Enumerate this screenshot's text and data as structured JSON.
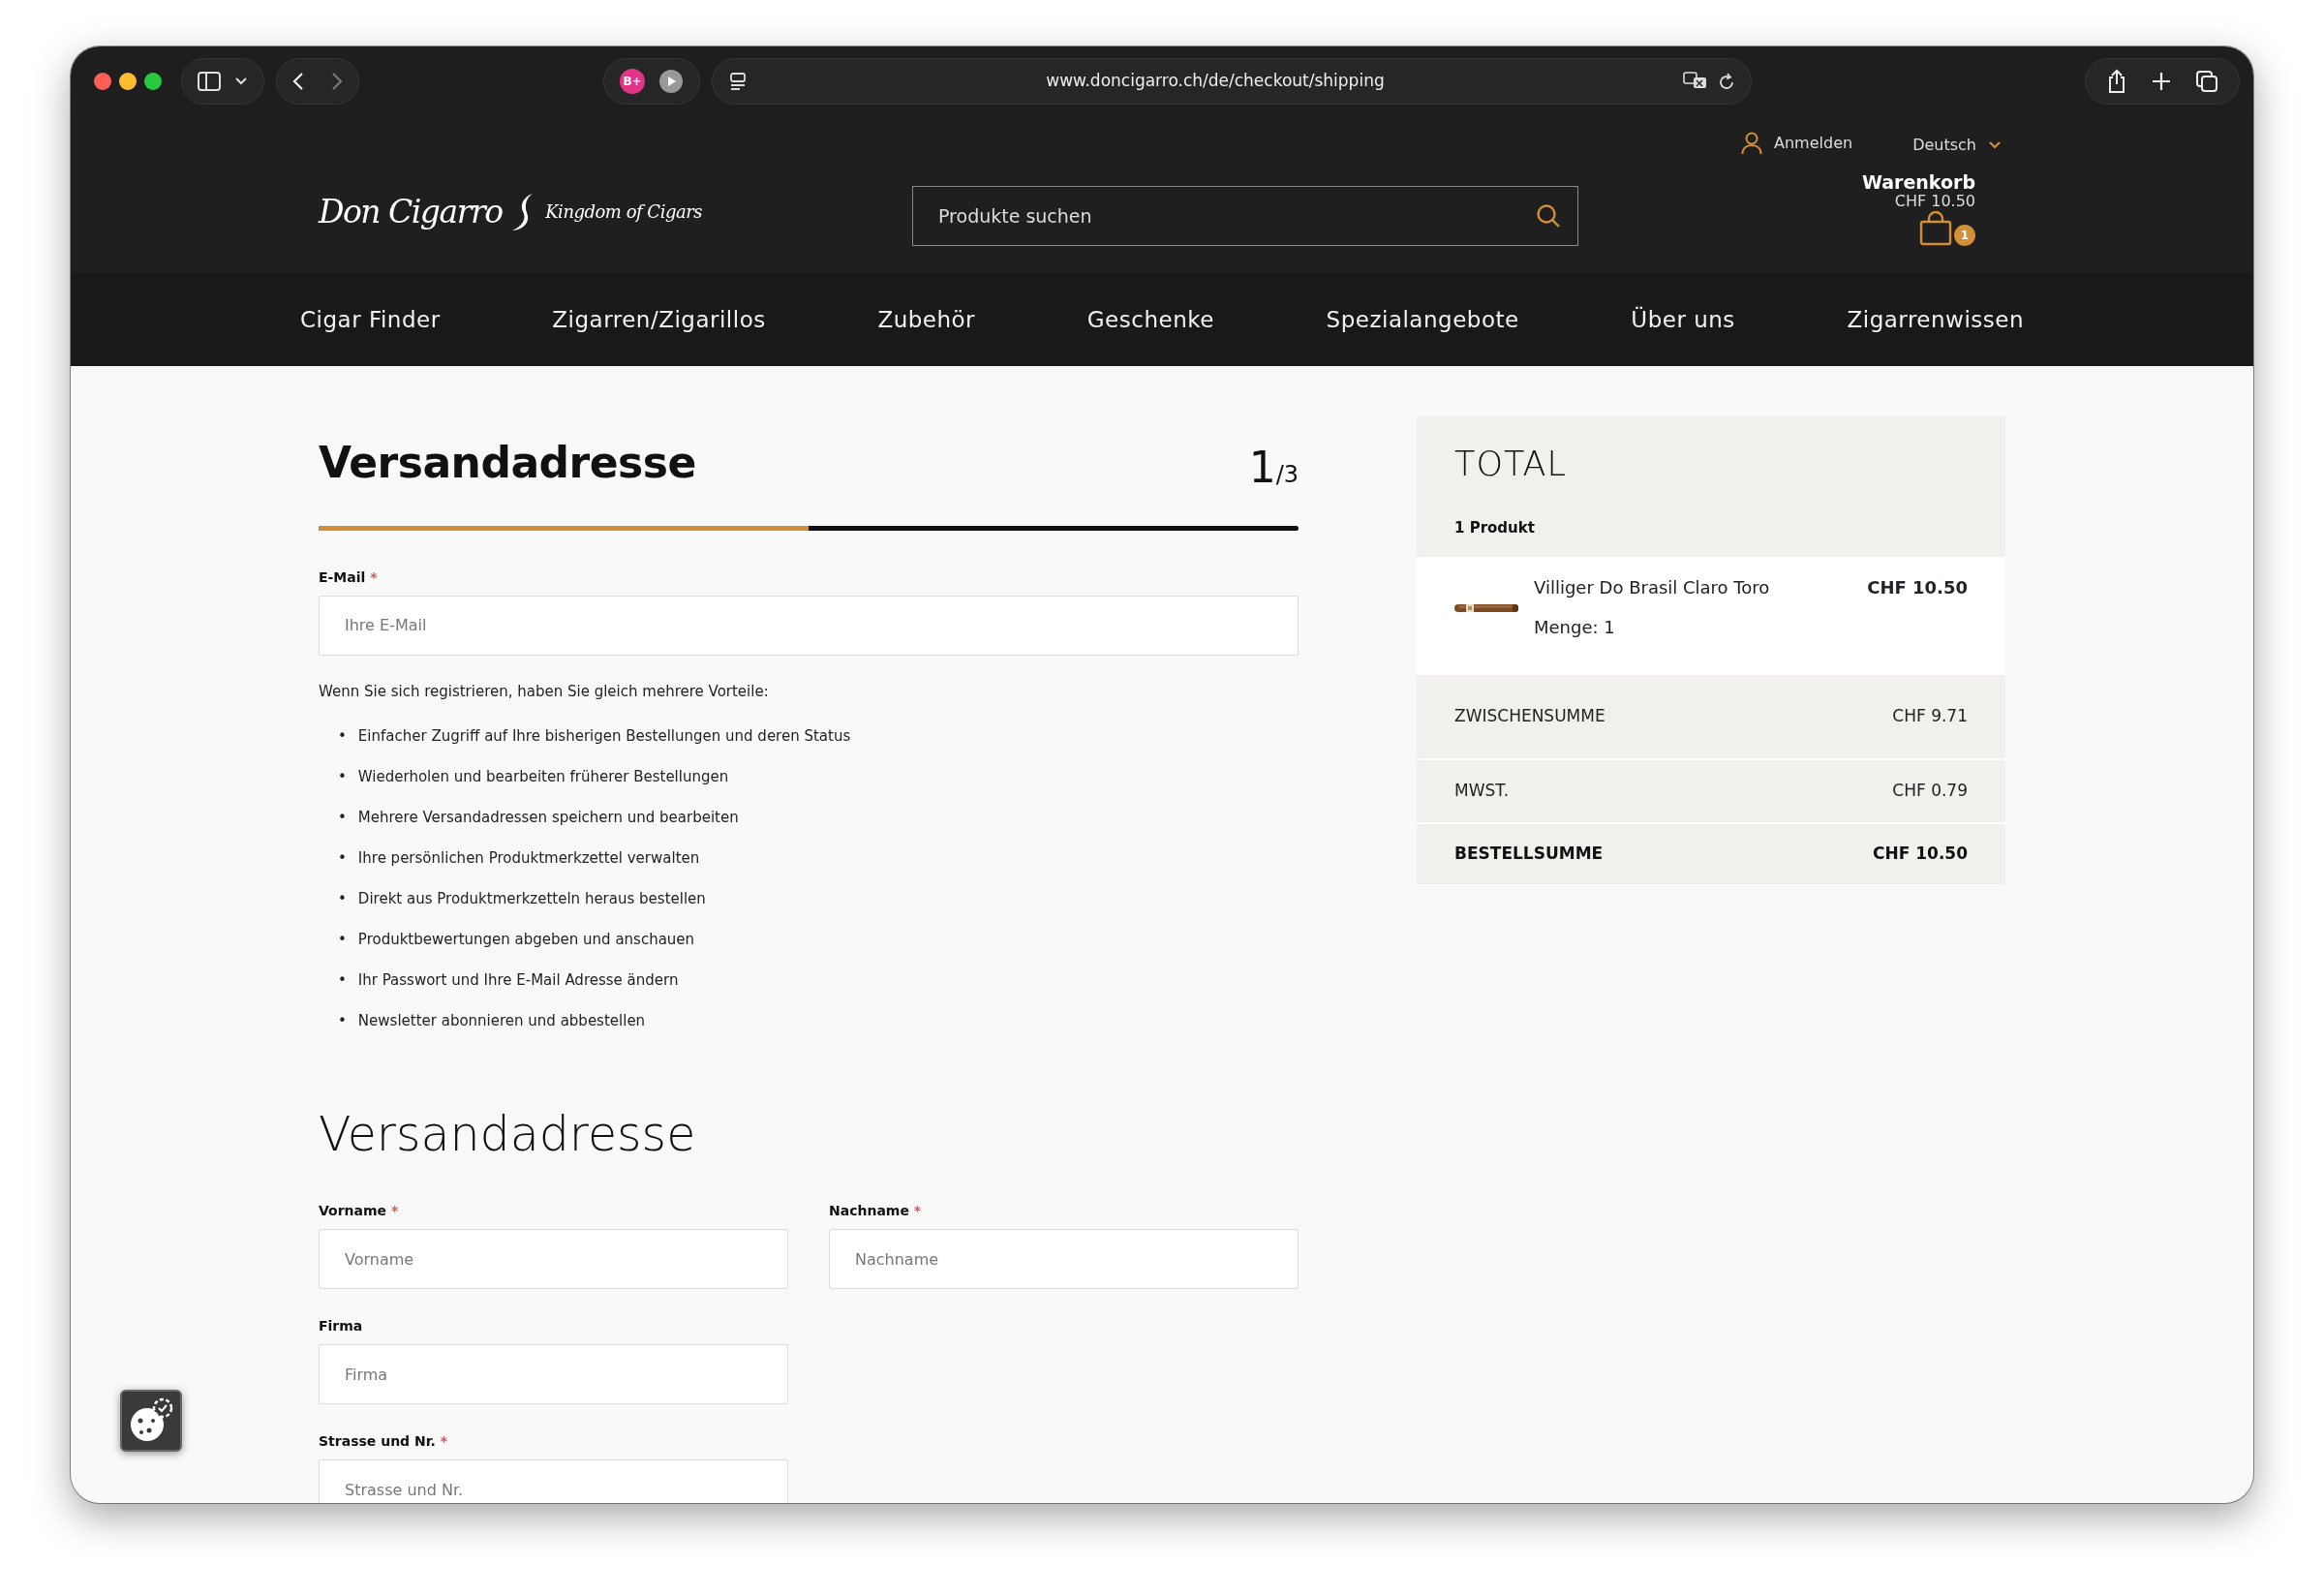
{
  "browser": {
    "url": "www.doncigarro.ch/de/checkout/shipping",
    "extension_label": "B+"
  },
  "header": {
    "logo": {
      "name": "Don Cigarro",
      "tagline": "Kingdom of Cigars"
    },
    "login": "Anmelden",
    "language": "Deutsch",
    "search": {
      "placeholder": "Produkte suchen"
    },
    "cart": {
      "title": "Warenkorb",
      "total": "CHF 10.50",
      "count": "1"
    }
  },
  "nav": [
    "Cigar Finder",
    "Zigarren/Zigarillos",
    "Zubehör",
    "Geschenke",
    "Spezialangebote",
    "Über uns",
    "Zigarrenwissen"
  ],
  "checkout": {
    "title": "Versandadresse",
    "step": "1",
    "step_of": "/3",
    "progress": {
      "level": 0.5
    },
    "email": {
      "label": "E-Mail",
      "mark": "*",
      "placeholder": "Ihre E-Mail"
    },
    "intro": "Wenn Sie sich registrieren, haben Sie gleich mehrere Vorteile:",
    "benefits": [
      {
        "bullet": "•",
        "text": "Einfacher Zugriff auf Ihre bisherigen Bestellungen und deren Status"
      },
      {
        "bullet": "•",
        "text": "Wiederholen und bearbeiten früherer Bestellungen"
      },
      {
        "bullet": "•",
        "text": "Mehrere Versandadressen speichern und bearbeiten"
      },
      {
        "bullet": "•",
        "text": "Ihre persönlichen Produktmerkzettel verwalten"
      },
      {
        "bullet": "•",
        "text": "Direkt aus Produktmerkzetteln heraus bestellen"
      },
      {
        "bullet": "•",
        "text": "Produktbewertungen abgeben und anschauen"
      },
      {
        "bullet": "•",
        "text": "Ihr Passwort und Ihre E-Mail Adresse ändern"
      },
      {
        "bullet": "•",
        "text": "Newsletter abonnieren und abbestellen"
      }
    ],
    "address_title": "Versandadresse",
    "field_rows": [
      [
        {
          "label": "Vorname",
          "mark": "*",
          "placeholder": "Vorname"
        },
        {
          "label": "Nachname",
          "mark": "*",
          "placeholder": "Nachname"
        }
      ],
      [
        {
          "label": "Firma",
          "placeholder": "Firma"
        }
      ],
      [
        {
          "label": "Strasse und Nr.",
          "mark": "*",
          "placeholder": "Strasse und Nr."
        }
      ]
    ]
  },
  "summary": {
    "title": "TOTAL",
    "count": "1 Produkt",
    "items": [
      {
        "name": "Villiger Do Brasil Claro Toro",
        "quantity": "Menge: 1",
        "price": "CHF 10.50"
      }
    ],
    "rows": [
      {
        "label": "ZWISCHENSUMME",
        "value": "CHF 9.71",
        "emphasis": false
      },
      {
        "label": "MWST.",
        "value": "CHF 0.79",
        "emphasis": false
      },
      {
        "label": "BESTELLSUMME",
        "value": "CHF 10.50",
        "emphasis": true
      }
    ]
  }
}
